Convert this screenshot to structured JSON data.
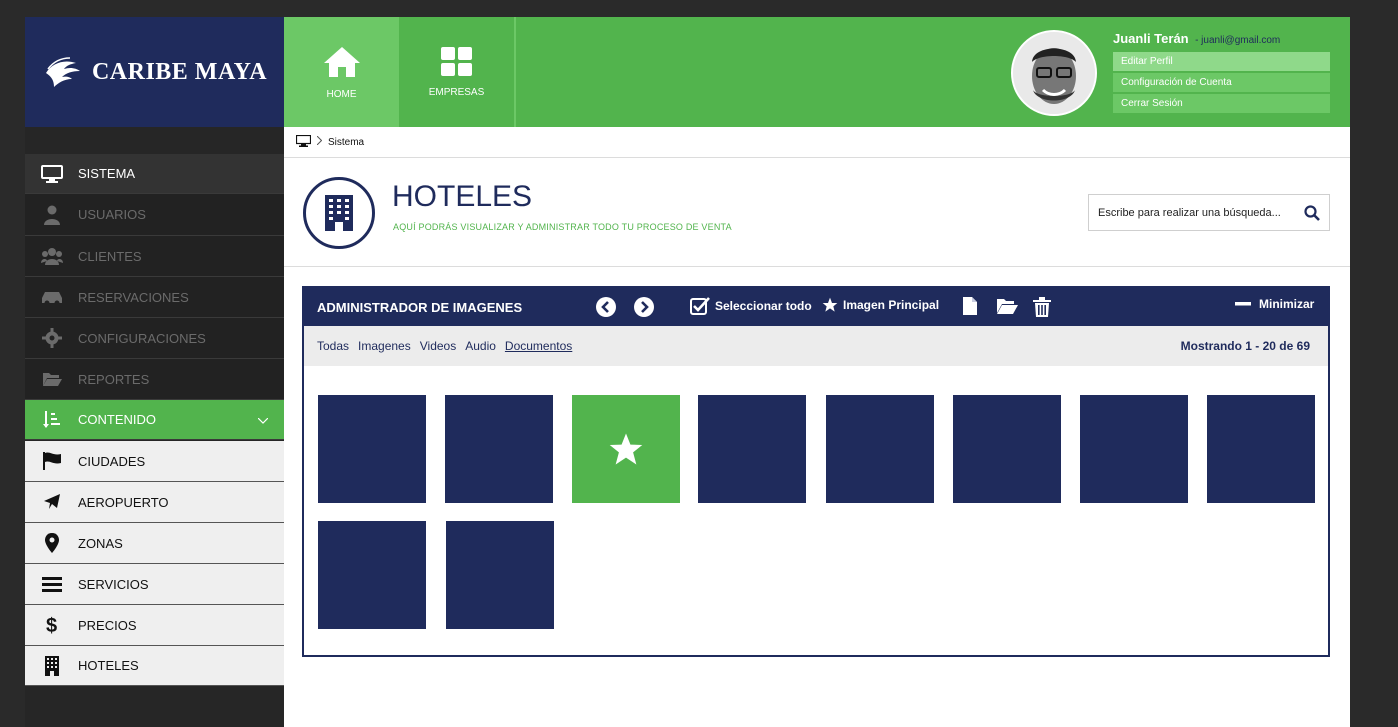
{
  "brand": {
    "name": "CARIBE MAYA"
  },
  "topnav": [
    {
      "label": "HOME",
      "icon": "home-icon"
    },
    {
      "label": "EMPRESAS",
      "icon": "grid-icon"
    }
  ],
  "user": {
    "name": "Juanli Terán",
    "email": "- juanli@gmail.com",
    "menu": [
      "Editar Perfil",
      "Configuración de Cuenta",
      "Cerrar Sesión"
    ]
  },
  "sidebar": {
    "items": [
      {
        "label": "SISTEMA",
        "icon": "monitor-icon"
      },
      {
        "label": "USUARIOS",
        "icon": "user-icon"
      },
      {
        "label": "CLIENTES",
        "icon": "users-icon"
      },
      {
        "label": "RESERVACIONES",
        "icon": "car-icon"
      },
      {
        "label": "CONFIGURACIONES",
        "icon": "gear-icon"
      },
      {
        "label": "REPORTES",
        "icon": "folder-icon"
      },
      {
        "label": "CONTENIDO",
        "icon": "sort-icon"
      },
      {
        "label": "CIUDADES",
        "icon": "flag-icon"
      },
      {
        "label": "AEROPUERTO",
        "icon": "plane-icon"
      },
      {
        "label": "ZONAS",
        "icon": "map-pin-icon"
      },
      {
        "label": "SERVICIOS",
        "icon": "list-icon"
      },
      {
        "label": "PRECIOS",
        "icon": "dollar-icon"
      },
      {
        "label": "HOTELES",
        "icon": "building-icon"
      }
    ]
  },
  "breadcrumb": {
    "current": "Sistema"
  },
  "page": {
    "title": "HOTELES",
    "subtitle": "AQUÍ PODRÁS VISUALIZAR Y ADMINISTRAR TODO TU PROCESO DE VENTA"
  },
  "search": {
    "placeholder": "Escribe para realizar una búsqueda..."
  },
  "manager": {
    "title": "ADMINISTRADOR DE IMAGENES",
    "select_all": "Seleccionar todo",
    "main_image": "Imagen Principal",
    "minimize": "Minimizar",
    "tabs": [
      "Todas",
      "Imagenes",
      "Videos",
      "Audio",
      "Documentos"
    ],
    "active_tab": "Documentos",
    "count": "Mostrando 1 - 20 de 69",
    "thumbnails_shown": 10,
    "featured_index": 2
  },
  "colors": {
    "navy": "#1f2b5c",
    "green": "#52b44d",
    "light_green": "#6cc866",
    "sidebar_dark": "#222222"
  }
}
